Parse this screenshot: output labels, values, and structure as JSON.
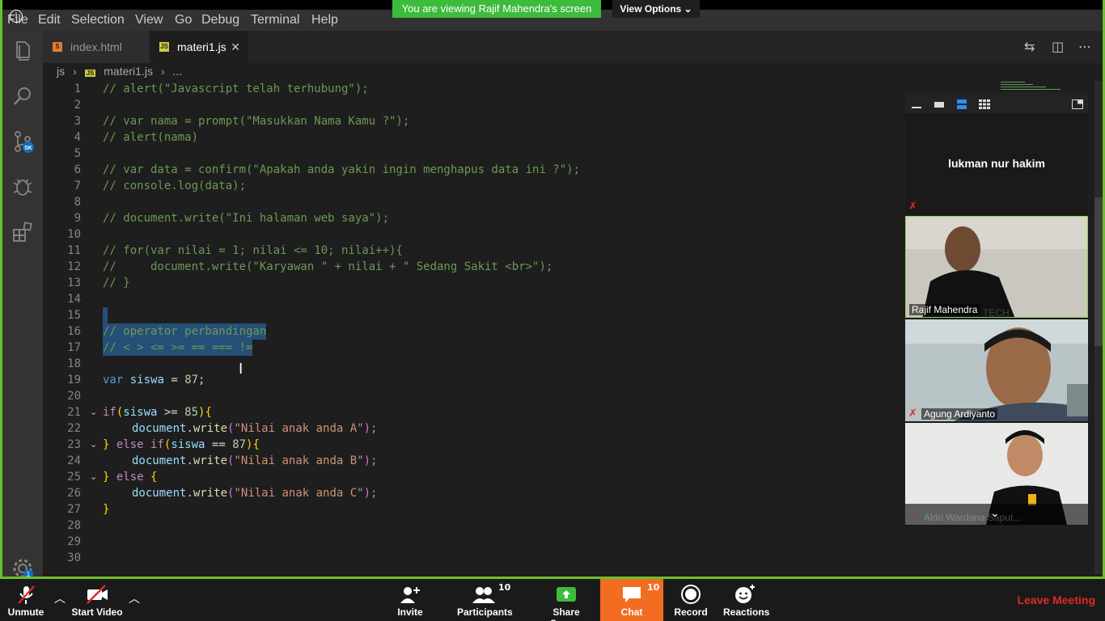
{
  "menu": [
    "File",
    "Edit",
    "Selection",
    "View",
    "Go",
    "Debug",
    "Terminal",
    "Help"
  ],
  "banner": {
    "viewing": "You are viewing Rajif Mahendra's screen",
    "view_options": "View Options ⌄"
  },
  "tabs": [
    {
      "label": "index.html",
      "icon": "html5-icon"
    },
    {
      "label": "materi1.js",
      "icon": "js-icon",
      "close": "✕"
    }
  ],
  "breadcrumb": {
    "folder": "js",
    "file": "materi1.js",
    "more": "..."
  },
  "activity": {
    "badge_sk": "SK",
    "badge_settings": "1"
  },
  "code": [
    {
      "n": "1",
      "t": "// alert(\"Javascript telah terhubung\");"
    },
    {
      "n": "2",
      "t": ""
    },
    {
      "n": "3",
      "t": "// var nama = prompt(\"Masukkan Nama Kamu ?\");"
    },
    {
      "n": "4",
      "t": "// alert(nama)"
    },
    {
      "n": "5",
      "t": ""
    },
    {
      "n": "6",
      "t": "// var data = confirm(\"Apakah anda yakin ingin menghapus data ini ?\");"
    },
    {
      "n": "7",
      "t": "// console.log(data);"
    },
    {
      "n": "8",
      "t": ""
    },
    {
      "n": "9",
      "t": "// document.write(\"Ini halaman web saya\");"
    },
    {
      "n": "10",
      "t": ""
    },
    {
      "n": "11",
      "t": "// for(var nilai = 1; nilai <= 10; nilai++){"
    },
    {
      "n": "12",
      "t": "//     document.write(\"Karyawan \" + nilai + \" Sedang Sakit <br>\");"
    },
    {
      "n": "13",
      "t": "// }"
    },
    {
      "n": "14",
      "t": ""
    },
    {
      "n": "15",
      "t": ""
    },
    {
      "n": "16",
      "t": "// operator perbandingan"
    },
    {
      "n": "17",
      "t": "// < > <= >= == === !="
    },
    {
      "n": "18",
      "t": ""
    },
    {
      "n": "19",
      "t": ""
    },
    {
      "n": "20",
      "t": ""
    },
    {
      "n": "21",
      "t": ""
    },
    {
      "n": "22",
      "t": ""
    },
    {
      "n": "23",
      "t": ""
    },
    {
      "n": "24",
      "t": ""
    },
    {
      "n": "25",
      "t": ""
    },
    {
      "n": "26",
      "t": ""
    },
    {
      "n": "27",
      "t": "}"
    },
    {
      "n": "28",
      "t": ""
    },
    {
      "n": "29",
      "t": ""
    },
    {
      "n": "30",
      "t": ""
    }
  ],
  "code_tokens": {
    "l19": {
      "kw": "var",
      "id": "siswa",
      "op": " = ",
      "num": "87",
      "end": ";"
    },
    "l21": {
      "kw": "if",
      "open": "(",
      "id": "siswa",
      "op": " >= ",
      "num": "85",
      "close": "){"
    },
    "l22": {
      "obj": "document",
      "dot": ".",
      "fn": "write",
      "p1": "(",
      "str": "\"Nilai anak anda A\"",
      "p2": ");"
    },
    "l23": {
      "b": "} ",
      "kw1": "else",
      "sp": " ",
      "kw2": "if",
      "open": "(",
      "id": "siswa",
      "op": " == ",
      "num": "87",
      "close": "){"
    },
    "l24": {
      "obj": "document",
      "dot": ".",
      "fn": "write",
      "p1": "(",
      "str": "\"Nilai anak anda B\"",
      "p2": ");"
    },
    "l25": {
      "b": "} ",
      "kw": "else",
      "open": " {"
    },
    "l26": {
      "obj": "document",
      "dot": ".",
      "fn": "write",
      "p1": "(",
      "str": "\"Nilai anak anda C\"",
      "p2": ");"
    }
  },
  "video": {
    "host": "lukman nur hakim",
    "tiles": [
      {
        "name": "Rajif Mahendra",
        "shirt_text": "TECH"
      },
      {
        "name": "Agung Ardiyanto"
      },
      {
        "name": "Aldo Wardana Saput..."
      }
    ]
  },
  "controls": {
    "unmute": "Unmute",
    "start_video": "Start Video",
    "invite": "Invite",
    "participants": "Participants",
    "participants_count": "10",
    "share": "Share Screen",
    "chat": "Chat",
    "chat_count": "10",
    "record": "Record",
    "reactions": "Reactions",
    "leave": "Leave Meeting"
  },
  "colors": {
    "zoom_green": "#3dbb3d",
    "chat_orange": "#f26d21",
    "leave_red": "#e02828",
    "selection": "#264f78"
  }
}
